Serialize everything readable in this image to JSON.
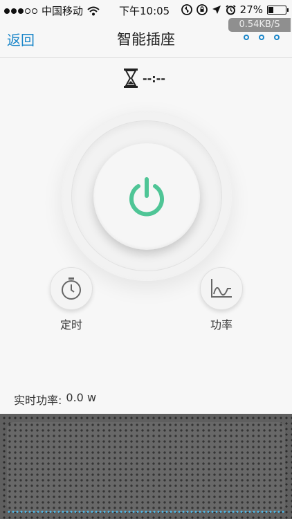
{
  "status_bar": {
    "carrier": "中国移动",
    "time": "下午10:05",
    "battery_text": "27%",
    "battery_level": 0.27
  },
  "speed_badge": "0.54KB/S",
  "nav": {
    "back_label": "返回",
    "title": "智能插座"
  },
  "timer": {
    "countdown": "--:--"
  },
  "controls": {
    "timer_label": "定时",
    "power_label": "功率"
  },
  "realtime_power": {
    "label": "实时功率:",
    "value": "0.0 w"
  },
  "colors": {
    "accent_blue": "#1a86c9",
    "power_green": "#4fc596"
  },
  "icons": {
    "power": "power-icon",
    "timer": "stopwatch-icon",
    "chart": "line-chart-icon",
    "hourglass": "hourglass-icon"
  }
}
